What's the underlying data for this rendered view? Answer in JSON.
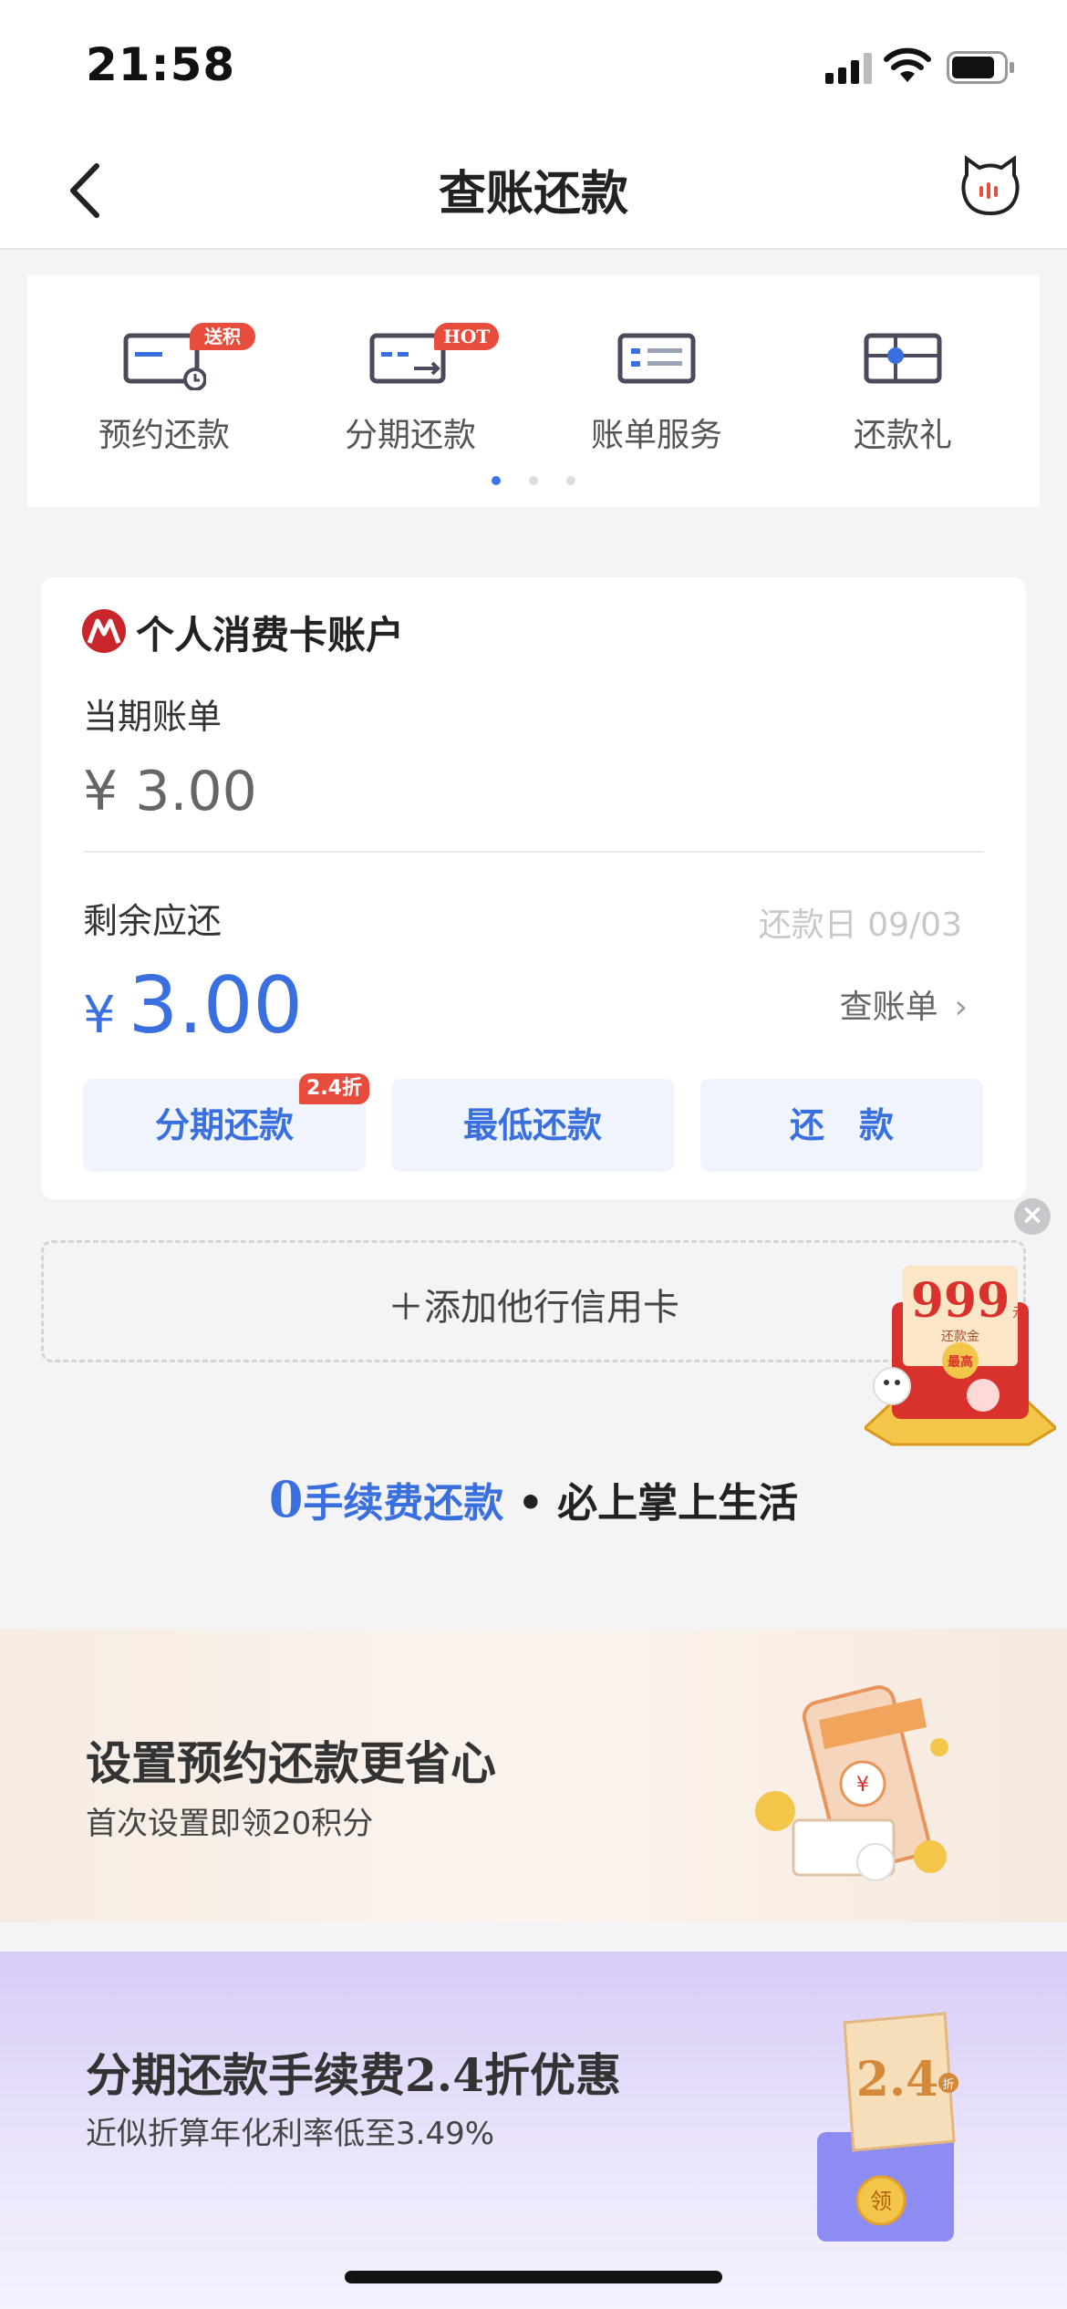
{
  "status_bar": {
    "time": "21:58"
  },
  "nav": {
    "title": "查账还款"
  },
  "quick_actions": [
    {
      "label": "预约还款",
      "badge": "送积分",
      "icon": "calendar-card-icon"
    },
    {
      "label": "分期还款",
      "badge": "HOT",
      "icon": "card-transfer-icon"
    },
    {
      "label": "账单服务",
      "badge": "",
      "icon": "bill-list-icon"
    },
    {
      "label": "还款礼",
      "badge": "",
      "icon": "gift-card-icon"
    }
  ],
  "pager": {
    "pages": 3,
    "active": 0
  },
  "account": {
    "name": "个人消费卡账户",
    "current_bill_label": "当期账单",
    "current_bill_amount": "¥ 3.00",
    "remaining_label": "剩余应还",
    "due_date": "还款日 09/03",
    "currency": "¥",
    "remaining_amount": "3.00",
    "view_bill": "查账单",
    "buttons": {
      "installment": "分期还款",
      "installment_badge": "2.4折",
      "minimum": "最低还款",
      "repay": "还　款"
    }
  },
  "add_card": {
    "label": "＋添加他行信用卡"
  },
  "promo_float": {
    "amount": "999",
    "unit": "元",
    "caption": "还款金",
    "tag": "最高"
  },
  "tagline": {
    "zero": "0",
    "blue": "手续费还款",
    "sep": " • ",
    "dark": "必上掌上生活"
  },
  "banners": [
    {
      "title": "设置预约还款更省心",
      "subtitle": "首次设置即领20积分"
    },
    {
      "title": "分期还款手续费2.4折优惠",
      "subtitle": "近似折算年化利率低至3.49%",
      "ticket": "2.4",
      "ticket_unit": "折",
      "coin": "领"
    }
  ],
  "colors": {
    "accent": "#3a6fe0",
    "badge": "#e74c3c",
    "brand_red": "#c8252c"
  }
}
